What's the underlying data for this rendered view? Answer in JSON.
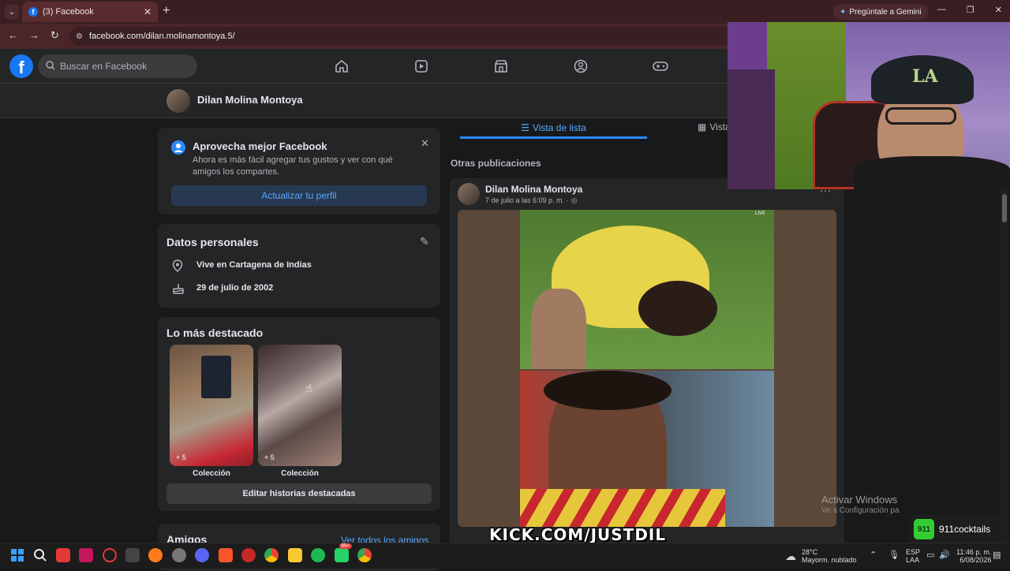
{
  "browser": {
    "tab_title": "(3) Facebook",
    "tab_close": "✕",
    "tab_menu": "⌄",
    "new_tab": "+",
    "url": "facebook.com/dilan.molinamontoya.5/",
    "gemini": "Pregúntale a Gemini",
    "window_controls": [
      "—",
      "❐",
      "✕"
    ]
  },
  "facebook": {
    "search_placeholder": "Buscar en Facebook",
    "profile_name": "Dilan Molina Montoya"
  },
  "promo": {
    "title": "Aprovecha mejor Facebook",
    "body": "Ahora es más fácil agregar tus gustos y ver con qué amigos los compartes.",
    "button": "Actualizar tu perfil",
    "close": "✕"
  },
  "personal": {
    "title": "Datos personales",
    "location": "Vive en Cartagena de Indias",
    "birthday": "29 de julio de 2002"
  },
  "highlights": {
    "title": "Lo más destacado",
    "items": [
      {
        "label": "Colección",
        "count": "+ 5"
      },
      {
        "label": "Colección",
        "count": "+ 5"
      }
    ],
    "edit_button": "Editar historias destacadas"
  },
  "friends": {
    "title": "Amigos",
    "see_all": "Ver todos los amigos"
  },
  "feed_tabs": {
    "list_view": "Vista de lista",
    "grid_view": "Vista"
  },
  "feed": {
    "section_title": "Otras publicaciones",
    "post": {
      "author": "Dilan Molina Montoya",
      "date": "7 de julio a las 6:09 p. m. ·",
      "more": "···"
    }
  },
  "overlay": {
    "activate_title": "Activar Windows",
    "activate_sub": "Ve a Configuración pa",
    "kick": "KICK.COM/JUSTDIL",
    "sponsor": "911cocktails",
    "sponsor_logo": "911"
  },
  "taskbar": {
    "weather_temp": "28°C",
    "weather_desc": "Mayorm. nublado",
    "lang_top": "ESP",
    "lang_bottom": "LAA",
    "time": "11:46 p. m.",
    "date": "6/08/2026",
    "badge": "99+"
  },
  "colors": {
    "fb_blue": "#1877f2",
    "link_blue": "#5aa7ff",
    "card_bg": "#242526",
    "page_bg": "#18191a"
  }
}
